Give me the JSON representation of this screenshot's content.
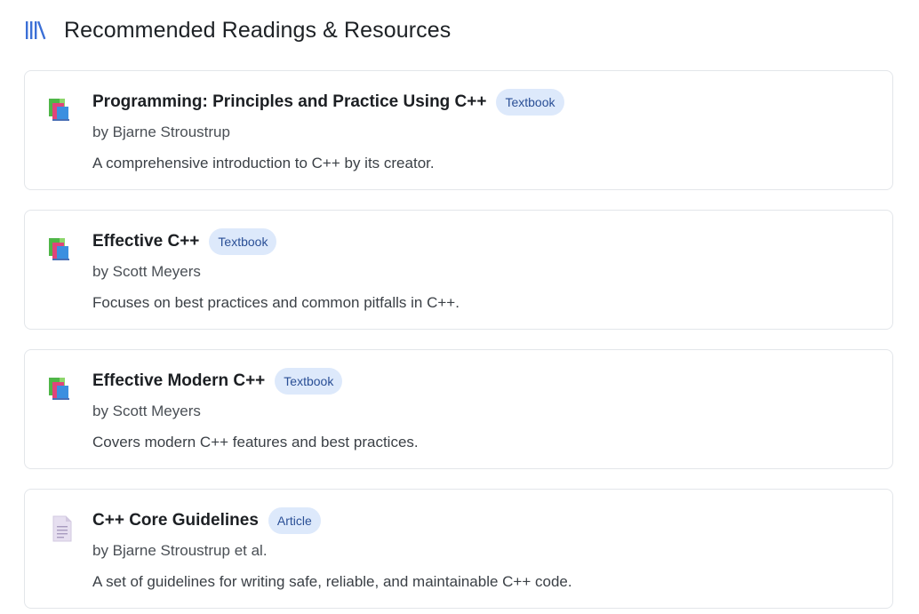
{
  "header": {
    "title": "Recommended Readings & Resources",
    "icon": "library-icon",
    "icon_color": "#3b6fd6"
  },
  "badge_colors": {
    "background": "#dde9fb",
    "text": "#2a4f96"
  },
  "resources": [
    {
      "title": "Programming: Principles and Practice Using C++",
      "type": "Textbook",
      "author": "by Bjarne Stroustrup",
      "description": "A comprehensive introduction to C++ by its creator.",
      "icon": "books-icon"
    },
    {
      "title": "Effective C++",
      "type": "Textbook",
      "author": "by Scott Meyers",
      "description": "Focuses on best practices and common pitfalls in C++.",
      "icon": "books-icon"
    },
    {
      "title": "Effective Modern C++",
      "type": "Textbook",
      "author": "by Scott Meyers",
      "description": "Covers modern C++ features and best practices.",
      "icon": "books-icon"
    },
    {
      "title": "C++ Core Guidelines",
      "type": "Article",
      "author": "by Bjarne Stroustrup et al.",
      "description": "A set of guidelines for writing safe, reliable, and maintainable C++ code.",
      "icon": "document-icon"
    }
  ]
}
